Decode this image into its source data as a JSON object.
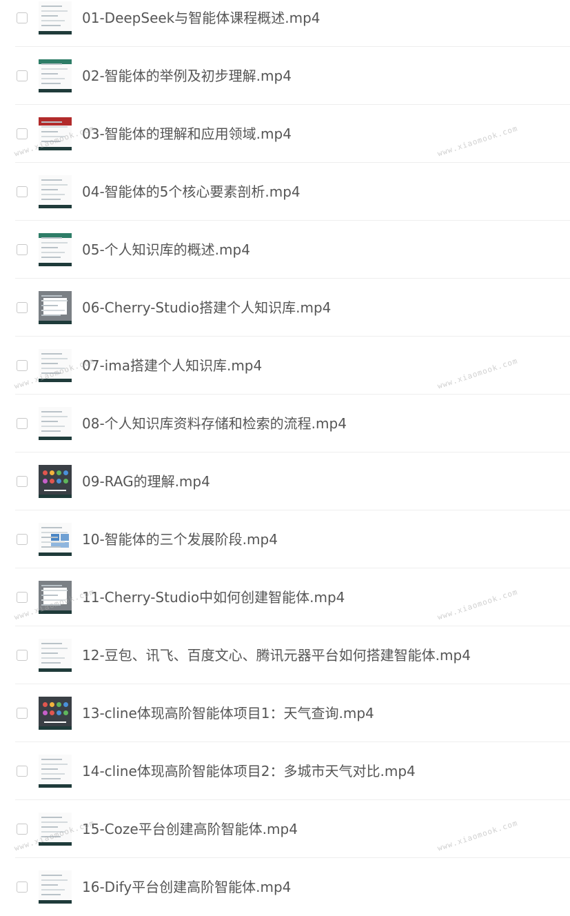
{
  "files": [
    {
      "name": "01-DeepSeek与智能体课程概述.mp4",
      "thumb": "plain"
    },
    {
      "name": "02-智能体的举例及初步理解.mp4",
      "thumb": "green"
    },
    {
      "name": "03-智能体的理解和应用领域.mp4",
      "thumb": "red"
    },
    {
      "name": "04-智能体的5个核心要素剖析.mp4",
      "thumb": "plain"
    },
    {
      "name": "05-个人知识库的概述.mp4",
      "thumb": "green"
    },
    {
      "name": "06-Cherry-Studio搭建个人知识库.mp4",
      "thumb": "grey"
    },
    {
      "name": "07-ima搭建个人知识库.mp4",
      "thumb": "plain"
    },
    {
      "name": "08-个人知识库资料存储和检索的流程.mp4",
      "thumb": "plain"
    },
    {
      "name": "09-RAG的理解.mp4",
      "thumb": "dark"
    },
    {
      "name": "10-智能体的三个发展阶段.mp4",
      "thumb": "blue"
    },
    {
      "name": "11-Cherry-Studio中如何创建智能体.mp4",
      "thumb": "grey"
    },
    {
      "name": "12-豆包、讯飞、百度文心、腾讯元器平台如何搭建智能体.mp4",
      "thumb": "plain"
    },
    {
      "name": "13-cline体现高阶智能体项目1：天气查询.mp4",
      "thumb": "dark"
    },
    {
      "name": "14-cline体现高阶智能体项目2：多城市天气对比.mp4",
      "thumb": "plain"
    },
    {
      "name": "15-Coze平台创建高阶智能体.mp4",
      "thumb": "plain"
    },
    {
      "name": "16-Dify平台创建高阶智能体.mp4",
      "thumb": "plain"
    }
  ],
  "watermark": "www.xiaomook.com"
}
